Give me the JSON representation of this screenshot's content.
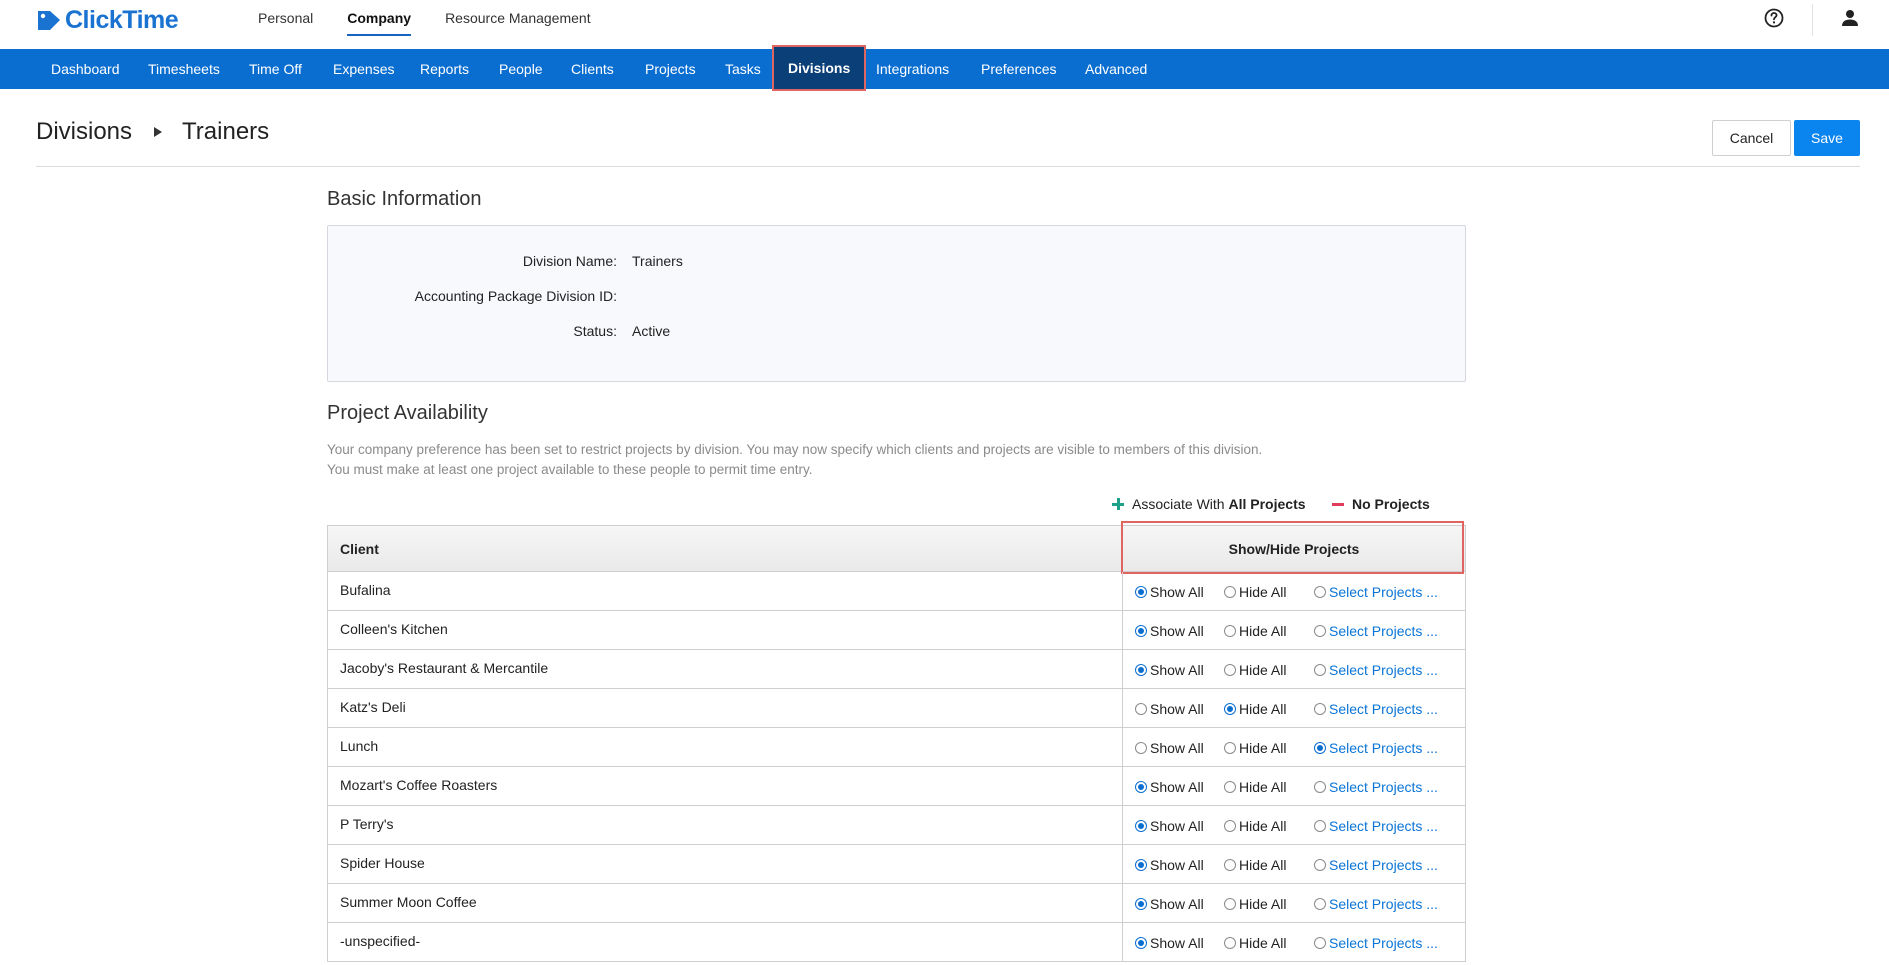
{
  "app": {
    "brand": "ClickTime",
    "brand_color": "#1a73d1",
    "nav_color": "#0a6ed1"
  },
  "topnav": [
    {
      "label": "Personal",
      "active": false
    },
    {
      "label": "Company",
      "active": true
    },
    {
      "label": "Resource Management",
      "active": false
    }
  ],
  "mainnav": [
    {
      "label": "Dashboard",
      "active": false
    },
    {
      "label": "Timesheets",
      "active": false
    },
    {
      "label": "Time Off",
      "active": false
    },
    {
      "label": "Expenses",
      "active": false
    },
    {
      "label": "Reports",
      "active": false
    },
    {
      "label": "People",
      "active": false
    },
    {
      "label": "Clients",
      "active": false
    },
    {
      "label": "Projects",
      "active": false
    },
    {
      "label": "Tasks",
      "active": false
    },
    {
      "label": "Divisions",
      "active": true
    },
    {
      "label": "Integrations",
      "active": false
    },
    {
      "label": "Preferences",
      "active": false
    },
    {
      "label": "Advanced",
      "active": false
    }
  ],
  "breadcrumb": {
    "parent": "Divisions",
    "current": "Trainers"
  },
  "actions": {
    "cancel": "Cancel",
    "save": "Save"
  },
  "basic_info": {
    "title": "Basic Information",
    "fields": [
      {
        "label": "Division Name:",
        "value": "Trainers"
      },
      {
        "label": "Accounting Package Division ID:",
        "value": ""
      },
      {
        "label": "Status:",
        "value": "Active"
      }
    ]
  },
  "availability": {
    "title": "Project Availability",
    "desc_line1": "Your company preference has been set to restrict projects by division. You may now specify which clients and projects are visible to members of this division.",
    "desc_line2": "You must make at least one project available to these people to permit time entry.",
    "legend_all_prefix": "Associate With",
    "legend_all_bold": "All Projects",
    "legend_none": "No Projects",
    "col_client": "Client",
    "col_show": "Show/Hide Projects",
    "opt_show": "Show All",
    "opt_hide": "Hide All",
    "opt_select": "Select Projects ...",
    "rows": [
      {
        "client": "Bufalina",
        "selected": "show"
      },
      {
        "client": "Colleen's Kitchen",
        "selected": "show"
      },
      {
        "client": "Jacoby's Restaurant & Mercantile",
        "selected": "show"
      },
      {
        "client": "Katz's Deli",
        "selected": "hide"
      },
      {
        "client": "Lunch",
        "selected": "select"
      },
      {
        "client": "Mozart's Coffee Roasters",
        "selected": "show"
      },
      {
        "client": "P Terry's",
        "selected": "show"
      },
      {
        "client": "Spider House",
        "selected": "show"
      },
      {
        "client": "Summer Moon Coffee",
        "selected": "show"
      },
      {
        "client": "-unspecified-",
        "selected": "show"
      }
    ]
  }
}
